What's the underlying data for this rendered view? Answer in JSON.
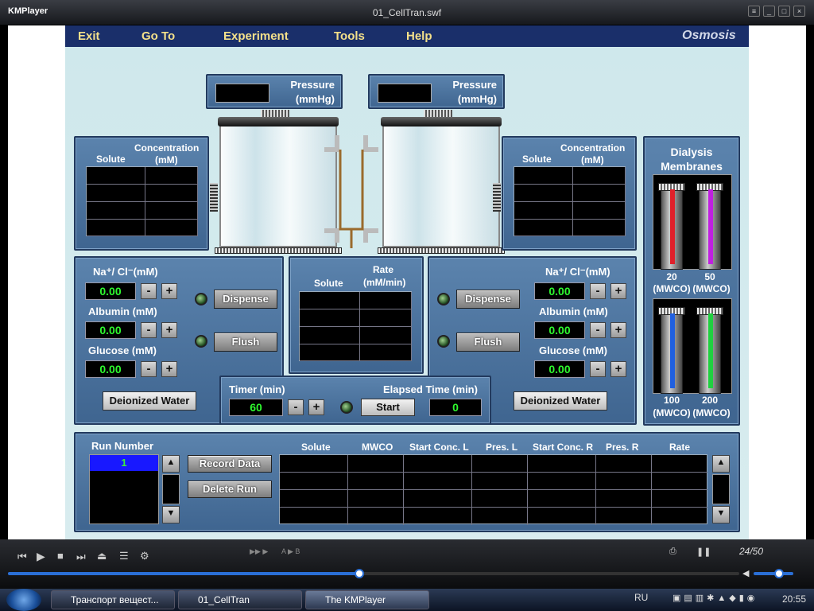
{
  "window": {
    "app": "KMPlayer",
    "title": "01_CellTran.swf"
  },
  "menu": {
    "items": [
      "Exit",
      "Go To",
      "Experiment",
      "Tools",
      "Help"
    ],
    "brand": "Osmosis"
  },
  "pressure": {
    "label1": "Pressure",
    "label2": "(mmHg)",
    "left_value": "",
    "right_value": ""
  },
  "conc_table": {
    "solute": "Solute",
    "conc1": "Concentration",
    "conc2": "(mM)"
  },
  "rate_table": {
    "solute": "Solute",
    "rate1": "Rate",
    "rate2": "(mM/min)"
  },
  "left": {
    "nacl": "Na⁺/ Cl⁻(mM)",
    "nacl_val": "0.00",
    "albumin": "Albumin (mM)",
    "albumin_val": "0.00",
    "glucose": "Glucose (mM)",
    "glucose_val": "0.00",
    "dispense": "Dispense",
    "flush": "Flush",
    "water": "Deionized Water"
  },
  "right": {
    "nacl": "Na⁺/ Cl⁻(mM)",
    "nacl_val": "0.00",
    "albumin": "Albumin (mM)",
    "albumin_val": "0.00",
    "glucose": "Glucose (mM)",
    "glucose_val": "0.00",
    "dispense": "Dispense",
    "flush": "Flush",
    "water": "Deionized Water"
  },
  "timer": {
    "label": "Timer (min)",
    "value": "60",
    "elapsed_label": "Elapsed Time (min)",
    "elapsed": "0",
    "start": "Start"
  },
  "membranes": {
    "title1": "Dialysis",
    "title2": "Membranes",
    "items": [
      {
        "size": "20",
        "unit": "(MWCO)",
        "color": "#e0202a"
      },
      {
        "size": "50",
        "unit": "(MWCO)",
        "color": "#c020e0"
      },
      {
        "size": "100",
        "unit": "(MWCO)",
        "color": "#2060e0"
      },
      {
        "size": "200",
        "unit": "(MWCO)",
        "color": "#20d040"
      }
    ]
  },
  "run": {
    "label": "Run Number",
    "value": "1",
    "record": "Record Data",
    "delete": "Delete Run",
    "headers": [
      "Solute",
      "MWCO",
      "Start Conc. L",
      "Pres. L",
      "Start Conc. R",
      "Pres. R",
      "Rate"
    ]
  },
  "pm": {
    "minus": "-",
    "plus": "+"
  },
  "player": {
    "counter": "24/50",
    "ab": "A ▶ B"
  },
  "taskbar": {
    "tasks": [
      "Транспорт вещест...",
      "01_CellTran",
      "The KMPlayer"
    ],
    "lang": "RU",
    "time": "20:55"
  }
}
